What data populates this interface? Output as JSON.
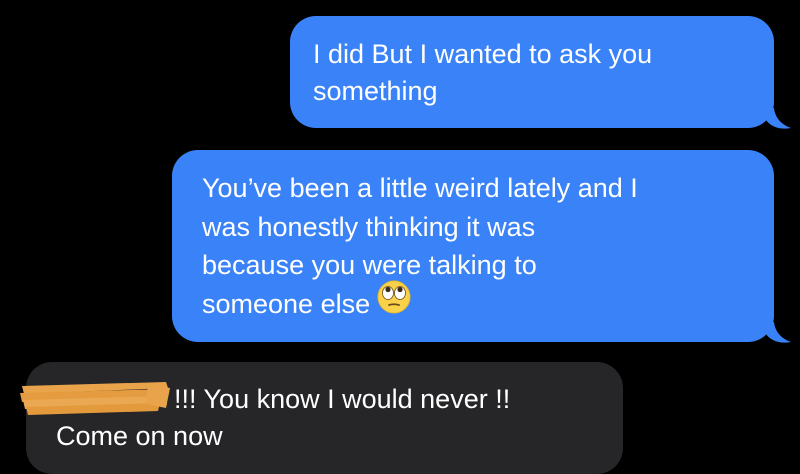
{
  "conversation": {
    "messages": [
      {
        "direction": "sent",
        "lines": [
          "I did But I wanted to ask you",
          "something"
        ]
      },
      {
        "direction": "sent",
        "lines": [
          "You’ve been a little weird lately and I",
          "was honestly thinking it was",
          "because you were talking to",
          "someone else"
        ],
        "trailing_emoji": "face-with-rolling-eyes-icon"
      },
      {
        "direction": "received",
        "lines": [
          "!!! You know I would never !!",
          "Come on now"
        ],
        "redacted_prefix": true
      }
    ]
  },
  "colors": {
    "background": "#000000",
    "sent_bubble": "#3a82f7",
    "received_bubble": "#262628",
    "text": "#ffffff",
    "redaction": "#e9a34a"
  }
}
